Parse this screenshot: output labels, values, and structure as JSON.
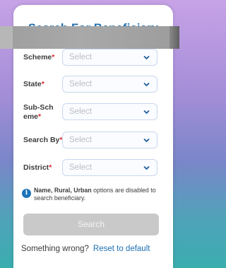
{
  "form": {
    "title": "Search For Beneficiary",
    "required_mark": "*",
    "fields": [
      {
        "label": "Scheme",
        "placeholder": "Select"
      },
      {
        "label": "State",
        "placeholder": "Select"
      },
      {
        "label": "Sub-Scheme",
        "placeholder": "Select"
      },
      {
        "label": "Search By",
        "placeholder": "Select"
      },
      {
        "label": "District",
        "placeholder": "Select"
      }
    ],
    "info_icon": "info-icon",
    "info_bold": "Name, Rural, Urban",
    "info_rest": " options are disabled to search beneficiary.",
    "search_label": "Search",
    "footer_question": "Something wrong?",
    "footer_link": "Reset to default"
  },
  "colors": {
    "title": "#1e6fb1",
    "required": "#e0242a",
    "link": "#1d6fb3",
    "button_disabled": "#c9c9c9"
  }
}
